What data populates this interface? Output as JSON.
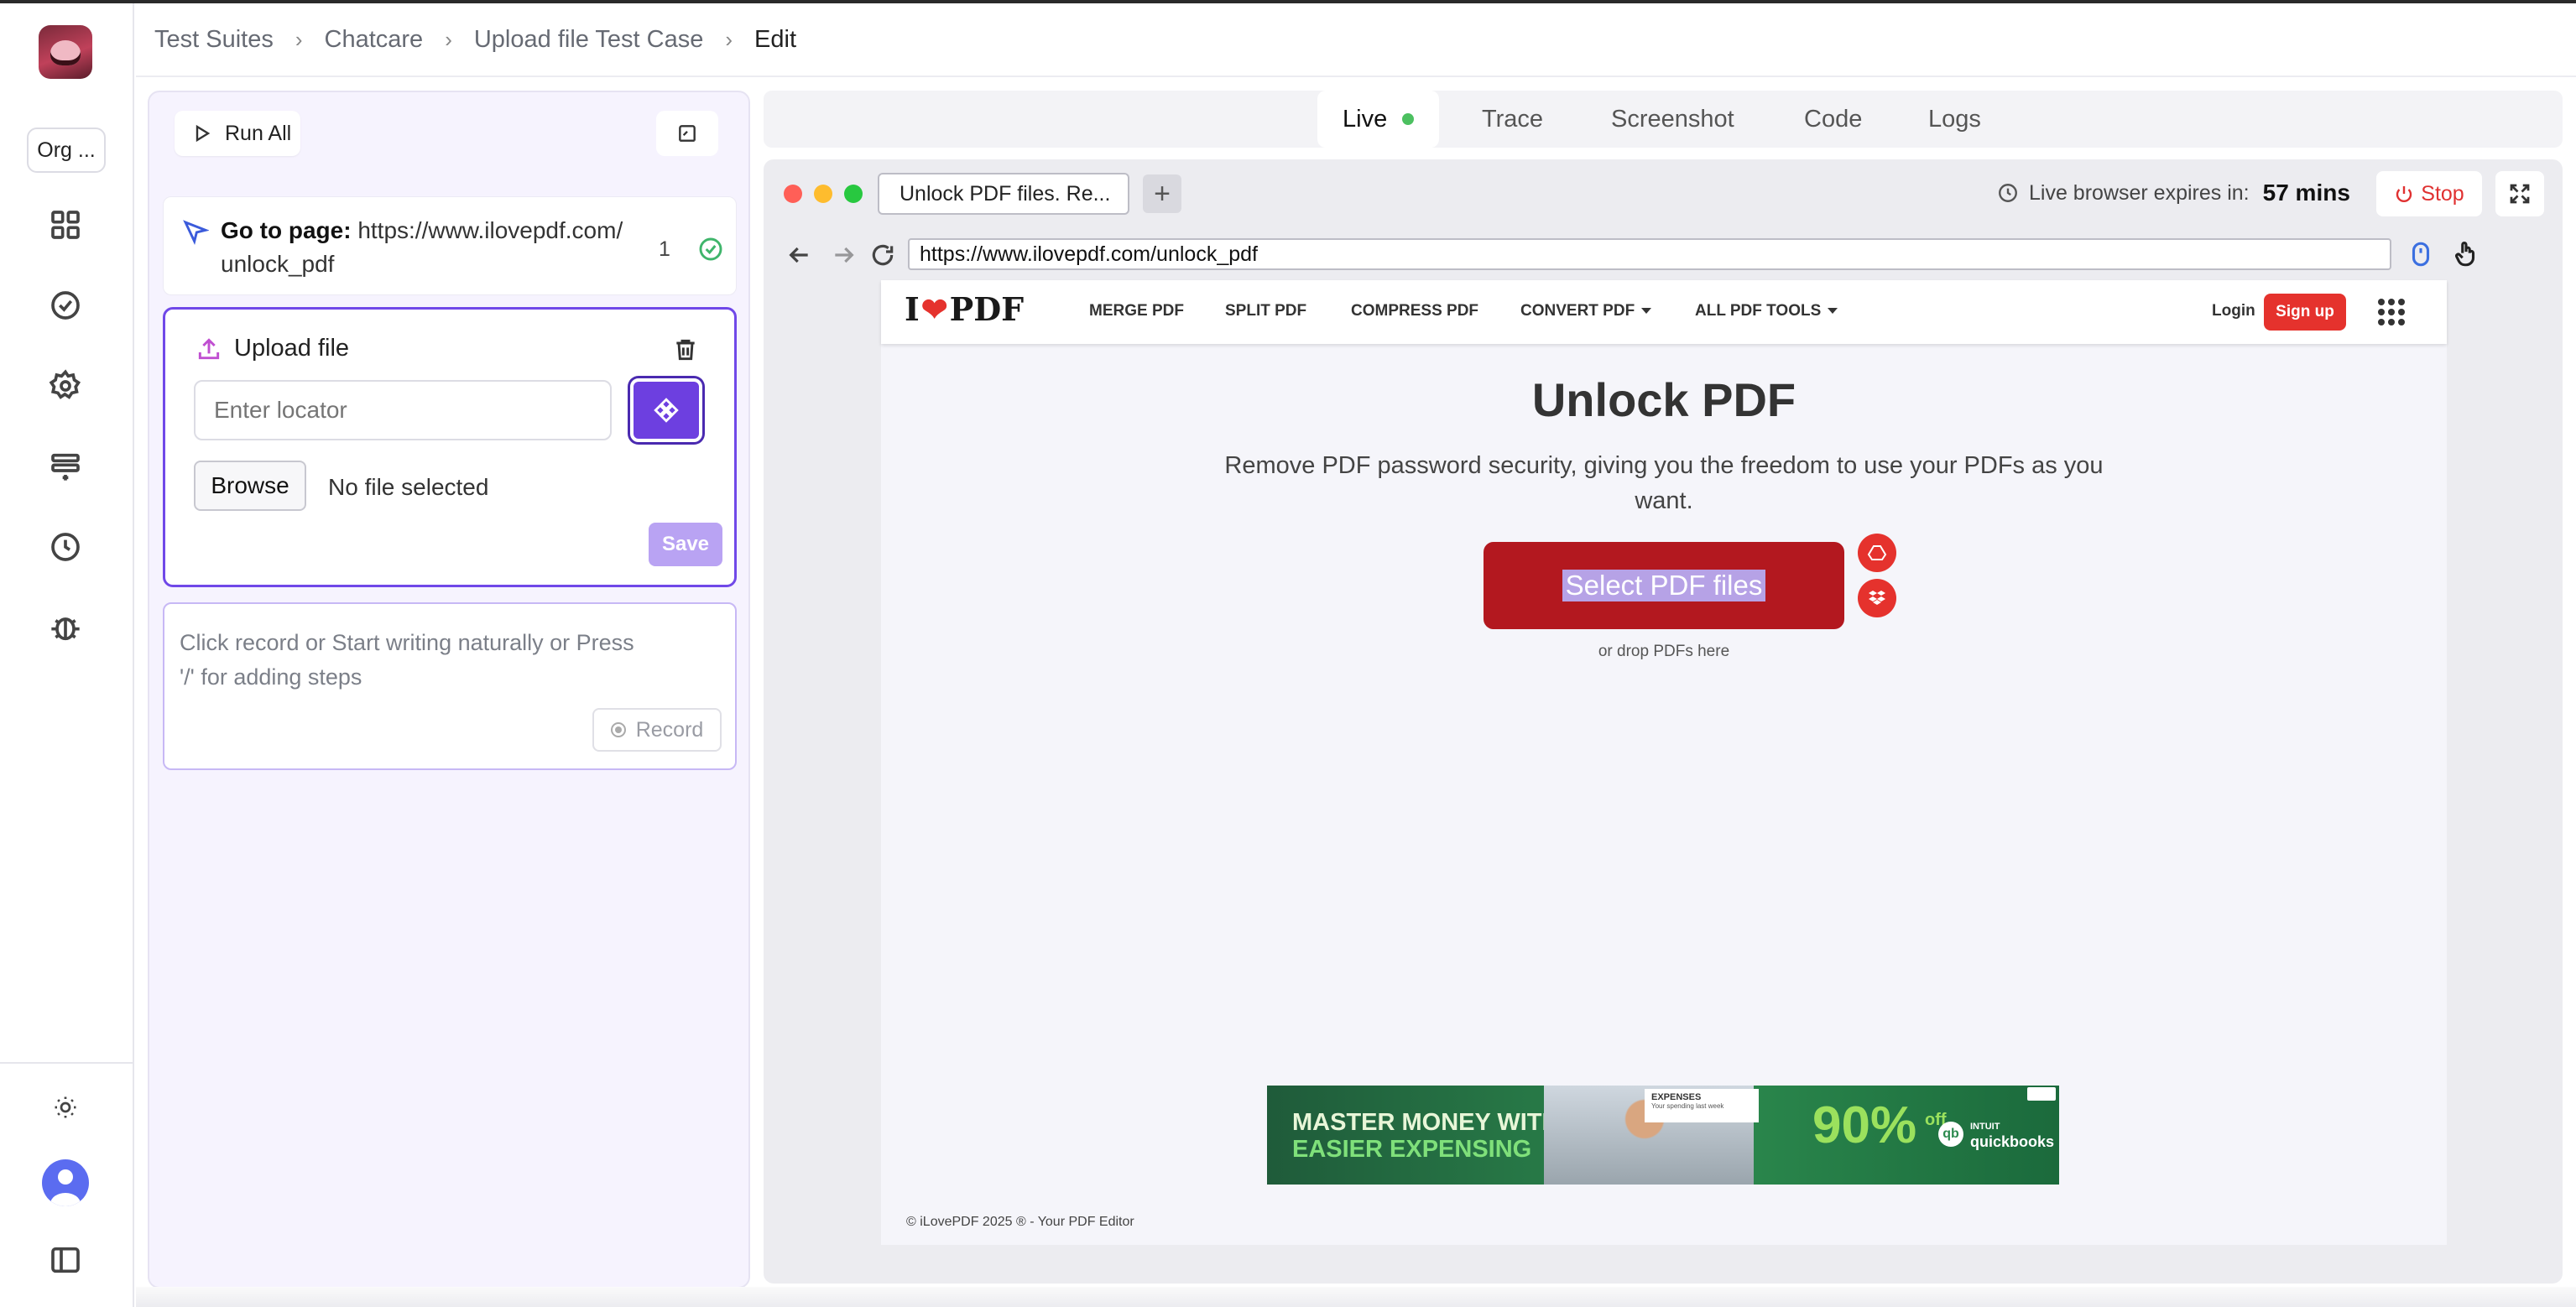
{
  "breadcrumb": [
    "Test Suites",
    "Chatcare",
    "Upload file Test Case",
    "Edit"
  ],
  "rail": {
    "org_label": "Org ...",
    "icons": [
      "dashboard-icon",
      "check-circle-icon",
      "gear-icon",
      "test-plan-icon",
      "clock-icon",
      "bug-icon",
      "sun-icon",
      "avatar",
      "sidebar-toggle-icon"
    ]
  },
  "panel": {
    "run_all_label": "Run All",
    "step1": {
      "prefix": "Go to page:",
      "url": "https://www.ilovepdf.com/unlock_pdf",
      "number": "1"
    },
    "upload": {
      "title": "Upload file",
      "locator_placeholder": "Enter locator",
      "browse_label": "Browse",
      "file_status": "No file selected",
      "save_label": "Save"
    },
    "input": {
      "hint": "Click record or Start writing naturally or Press '/' for adding steps",
      "record_label": "Record"
    }
  },
  "tabs": [
    "Live",
    "Trace",
    "Screenshot",
    "Code",
    "Logs"
  ],
  "browser": {
    "tab_title": "Unlock PDF files. Re...",
    "new_tab": "+",
    "expires_label": "Live browser expires in:",
    "expires_value": "57 mins",
    "stop_label": "Stop",
    "url": "https://www.ilovepdf.com/unlock_pdf"
  },
  "site": {
    "logo_left": "I",
    "logo_right": "PDF",
    "nav": [
      "MERGE PDF",
      "SPLIT PDF",
      "COMPRESS PDF",
      "CONVERT PDF",
      "ALL PDF TOOLS"
    ],
    "login": "Login",
    "signup": "Sign up",
    "title": "Unlock PDF",
    "subtitle": "Remove PDF password security, giving you the freedom to use your PDFs as you want.",
    "select_label": "Select PDF files",
    "drop_label": "or drop PDFs here",
    "footer": "© iLovePDF 2025 ® - Your PDF Editor",
    "ad": {
      "line1": "MASTER MONEY WITH",
      "line2": "EASIER EXPENSING",
      "card_title": "EXPENSES",
      "card_sub": "Your spending last week",
      "percent": "90%",
      "off": "off",
      "qb_mark": "qb",
      "brand_top": "INTUIT",
      "brand": "quickbooks"
    }
  },
  "colors": {
    "accent": "#7048e8",
    "ilovepdf_red": "#e5322d",
    "live_dot": "#4cc060"
  }
}
